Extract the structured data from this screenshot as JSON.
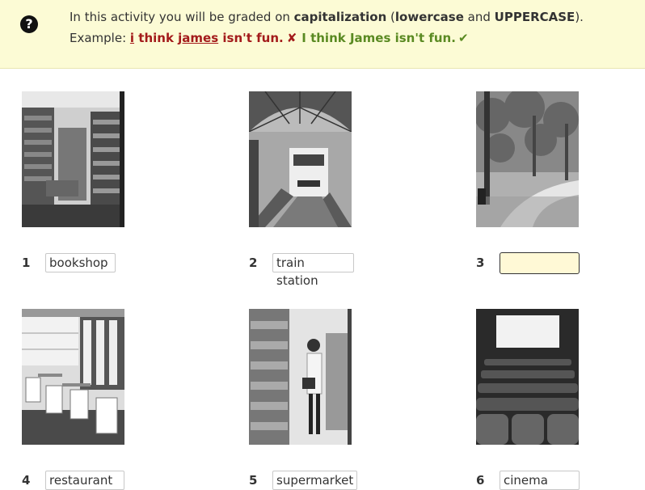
{
  "instructions": {
    "line1_prefix": "In this activity you will be graded on ",
    "capitalization": "capitalization",
    "open_paren": " (",
    "lowercase": "lowercase",
    "and": " and ",
    "uppercase": "UPPERCASE",
    "close": ").",
    "example_label": "Example: ",
    "wrong_i": "i",
    "wrong_think": " think ",
    "wrong_james": "james",
    "wrong_rest": " isn't fun.",
    "wrong_mark": "✘",
    "right_sentence": "I think James isn't fun.",
    "right_mark": "✔"
  },
  "items": [
    {
      "number": "1",
      "answer": "bookshop",
      "image": "bookshop-photo"
    },
    {
      "number": "2",
      "answer": "train station",
      "image": "train-station-photo"
    },
    {
      "number": "3",
      "answer": "",
      "image": "park-photo"
    },
    {
      "number": "4",
      "answer": "restaurant",
      "image": "restaurant-photo"
    },
    {
      "number": "5",
      "answer": "supermarket",
      "image": "supermarket-photo"
    },
    {
      "number": "6",
      "answer": "cinema",
      "image": "cinema-photo"
    }
  ]
}
